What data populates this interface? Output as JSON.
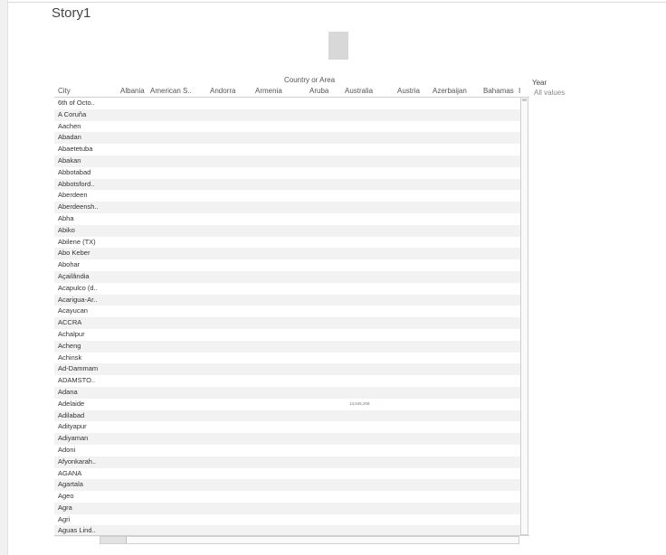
{
  "story": {
    "title": "Story1"
  },
  "grid": {
    "column_header_title": "Country or Area",
    "row_header_title": "City",
    "columns": [
      "Albania",
      "American S..",
      "Andorra",
      "Armenia",
      "Aruba",
      "Australia",
      "Austria",
      "Azerbaijan",
      "Bahamas",
      "I"
    ],
    "rows": [
      "6th of Octo..",
      "A Coruña",
      "Aachen",
      "Abadan",
      "Abaetetuba",
      "Abakan",
      "Abbotabad",
      "Abbotsford..",
      "Aberdeen",
      "Aberdeensh..",
      "Abha",
      "Abiko",
      "Abilene (TX)",
      "Abo Keber",
      "Abohar",
      "Açailândia",
      "Acapulco (d..",
      "Acarigua-Ar..",
      "Acayucan",
      "ACCRA",
      "Achalpur",
      "Acheng",
      "Achinsk",
      "Ad-Dammam",
      "ADAMSTO..",
      "Adana",
      "Adelaide",
      "Adilabad",
      "Adityapur",
      "Adiyaman",
      "Adoni",
      "Afyonkarah..",
      "AGANA",
      "Agartala",
      "Ageo",
      "Agra",
      "Agri",
      "Aguas Lind.."
    ],
    "cell_values": [
      {
        "row": "Adelaide",
        "column": "Australia",
        "value": "13,645,206"
      }
    ]
  },
  "filter": {
    "title": "Year",
    "value": "All values"
  }
}
